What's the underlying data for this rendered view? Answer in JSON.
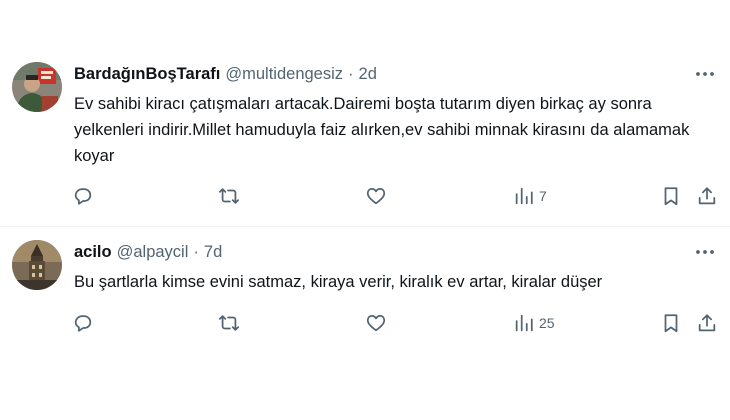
{
  "tweets": [
    {
      "display_name": "BardağınBoşTarafı",
      "handle": "@multidengesiz",
      "separator": "·",
      "time": "2d",
      "text": "Ev sahibi kiracı çatışmaları artacak.Dairemi boşta tutarım diyen birkaç ay sonra yelkenleri indirir.Millet hamuduyla faiz alırken,ev sahibi minnak kirasını da alamamak koyar",
      "views": "7",
      "avatar_icon": "avatar-person-icon"
    },
    {
      "display_name": "acilo",
      "handle": "@alpaycil",
      "separator": "·",
      "time": "7d",
      "text": "Bu şartlarla kimse evini satmaz, kiraya verir, kiralık ev artar, kiralar düşer",
      "views": "25",
      "avatar_icon": "avatar-tower-icon"
    }
  ],
  "colors": {
    "text": "#0f1419",
    "secondary": "#536471",
    "divider": "#eff3f4"
  }
}
